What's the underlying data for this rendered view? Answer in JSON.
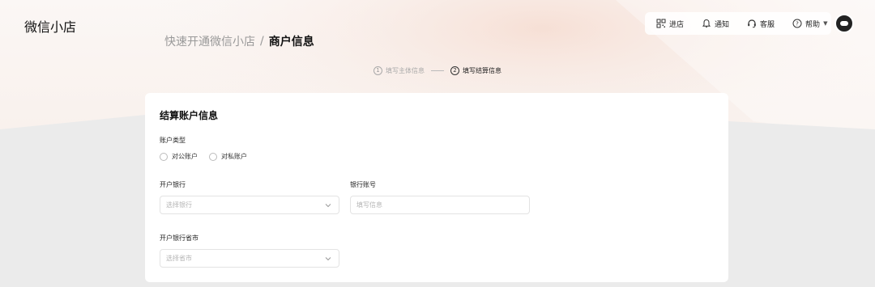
{
  "app": {
    "logo": "微信小店"
  },
  "topbar": {
    "items": [
      {
        "label": "进店",
        "icon": "store-qr-icon"
      },
      {
        "label": "通知",
        "icon": "bell-icon"
      },
      {
        "label": "客服",
        "icon": "headset-icon"
      },
      {
        "label": "帮助",
        "icon": "help-icon"
      }
    ]
  },
  "breadcrumb": {
    "parent": "快速开通微信小店",
    "separator": "/",
    "current": "商户信息"
  },
  "steps": [
    {
      "num": "1",
      "label": "填写主体信息",
      "state": "inactive"
    },
    {
      "num": "2",
      "label": "填写结算信息",
      "state": "active"
    }
  ],
  "form": {
    "title": "结算账户信息",
    "account_type": {
      "label": "账户类型",
      "options": [
        "对公账户",
        "对私账户"
      ]
    },
    "bank": {
      "label": "开户银行",
      "placeholder": "选择银行"
    },
    "account_no": {
      "label": "银行账号",
      "placeholder": "填写信息"
    },
    "province": {
      "label": "开户银行省市",
      "placeholder": "选择省市"
    }
  },
  "colors": {
    "accent": "#111111",
    "placeholder": "#b5b5b5",
    "border": "#e3e3e3"
  }
}
